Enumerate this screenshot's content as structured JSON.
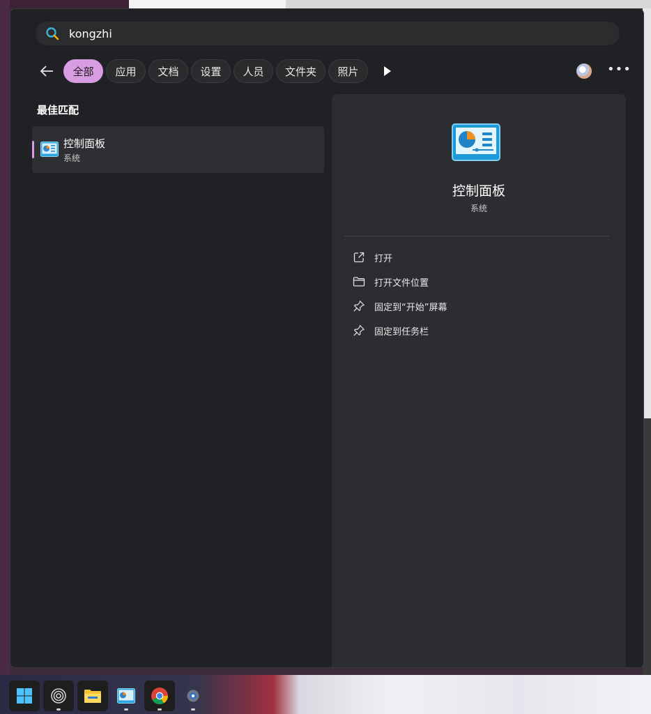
{
  "search": {
    "query": "kongzhi"
  },
  "filters": {
    "tabs": [
      "全部",
      "应用",
      "文档",
      "设置",
      "人员",
      "文件夹",
      "照片"
    ],
    "active_tab": "全部"
  },
  "results": {
    "heading": "最佳匹配",
    "best_match": {
      "title": "控制面板",
      "subtitle": "系统"
    }
  },
  "details": {
    "title": "控制面板",
    "subtitle": "系统",
    "actions": [
      {
        "label": "打开",
        "icon": "open-external-icon"
      },
      {
        "label": "打开文件位置",
        "icon": "folder-icon"
      },
      {
        "label": "固定到“开始”屏幕",
        "icon": "pin-icon"
      },
      {
        "label": "固定到任务栏",
        "icon": "pin-icon"
      }
    ]
  },
  "taskbar": {
    "items": [
      "start-icon",
      "cortana-icon",
      "file-explorer-icon",
      "control-panel-icon",
      "chrome-icon",
      "settings-icon"
    ]
  },
  "colors": {
    "accent": "#d79ce2",
    "panel_bg": "#202124",
    "details_bg": "#2b2d30"
  }
}
